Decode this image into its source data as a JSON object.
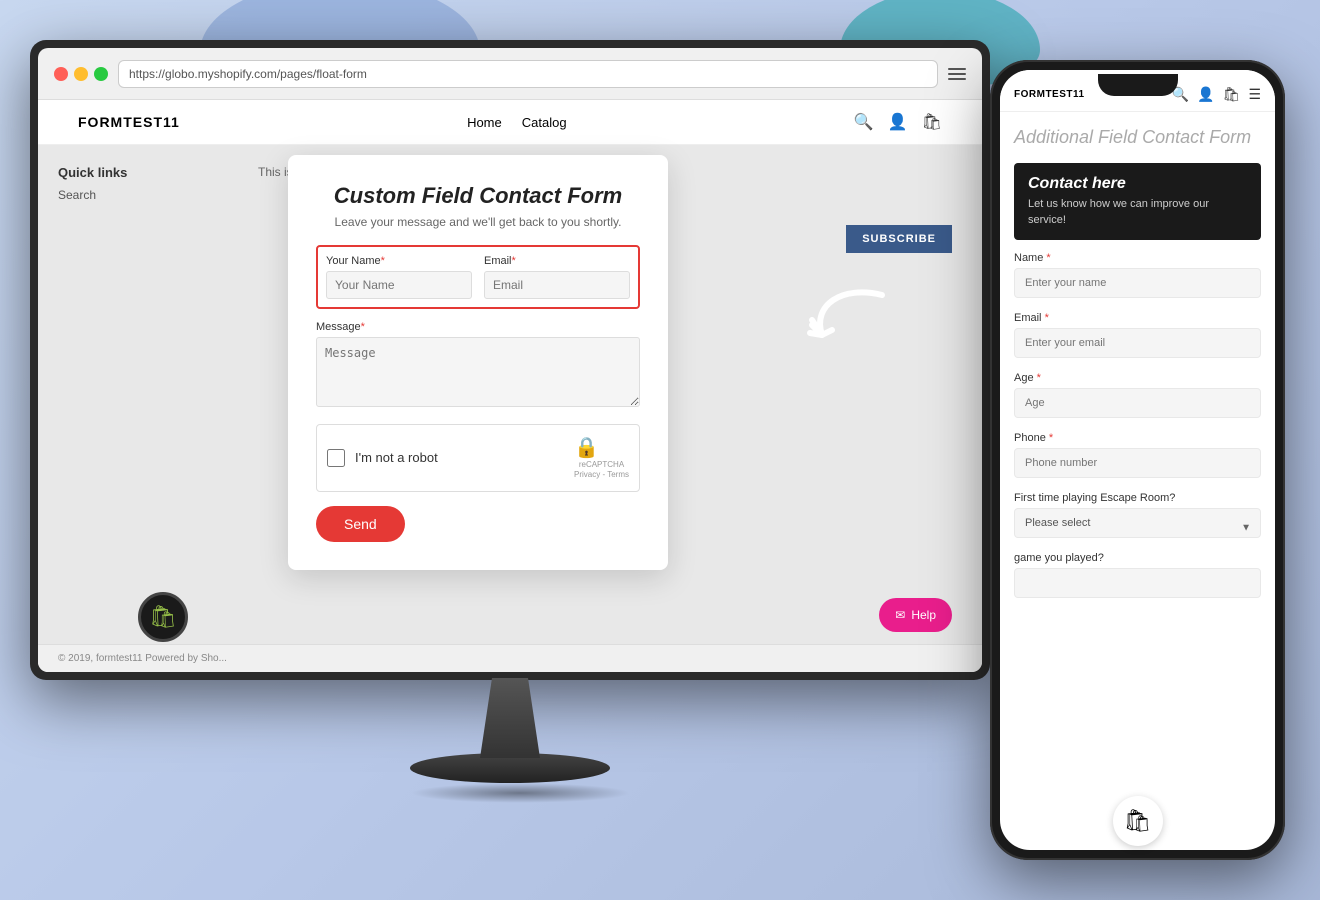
{
  "blobs": {},
  "monitor": {
    "browser": {
      "url": "https://globo.myshopify.com/pages/float-form"
    },
    "store": {
      "logo": "FORMTEST11",
      "nav": [
        "Home",
        "Catalog"
      ],
      "footer_text": "© 2019, formtest11 Powered by Sho..."
    },
    "sidebar": {
      "title": "Quick links",
      "links": [
        "Search"
      ]
    },
    "demo_text": "This is a demo p...",
    "contact_form": {
      "title": "Custom Field Contact Form",
      "subtitle": "Leave your message and we'll get back to you shortly.",
      "name_label": "Your Name",
      "name_required": "*",
      "name_placeholder": "Your Name",
      "email_label": "Email",
      "email_required": "*",
      "email_placeholder": "Email",
      "message_label": "Message",
      "message_required": "*",
      "message_placeholder": "Message",
      "captcha_label": "I'm not a robot",
      "captcha_brand": "reCAPTCHA",
      "captcha_sub1": "Privacy",
      "captcha_sub2": "Terms",
      "send_button": "Send"
    },
    "subscribe_button": "SUBSCRIBE",
    "help_button": "Help"
  },
  "phone": {
    "logo": "FORMTEST11",
    "page_title": "Additional Field Contact Form",
    "panel": {
      "title": "Contact here",
      "subtitle": "Let us know how we can improve our service!"
    },
    "fields": [
      {
        "label": "Name",
        "required": true,
        "placeholder": "Enter your name",
        "type": "input"
      },
      {
        "label": "Email",
        "required": true,
        "placeholder": "Enter your email",
        "type": "input"
      },
      {
        "label": "Age",
        "required": true,
        "placeholder": "Age",
        "type": "input"
      },
      {
        "label": "Phone",
        "required": true,
        "placeholder": "Phone number",
        "type": "input"
      },
      {
        "label": "First time playing Escape Room?",
        "required": false,
        "placeholder": "Please select",
        "type": "select"
      },
      {
        "label": "game you played?",
        "required": false,
        "placeholder": "",
        "type": "input"
      }
    ]
  },
  "decorative": {
    "arrow_text": "→"
  }
}
